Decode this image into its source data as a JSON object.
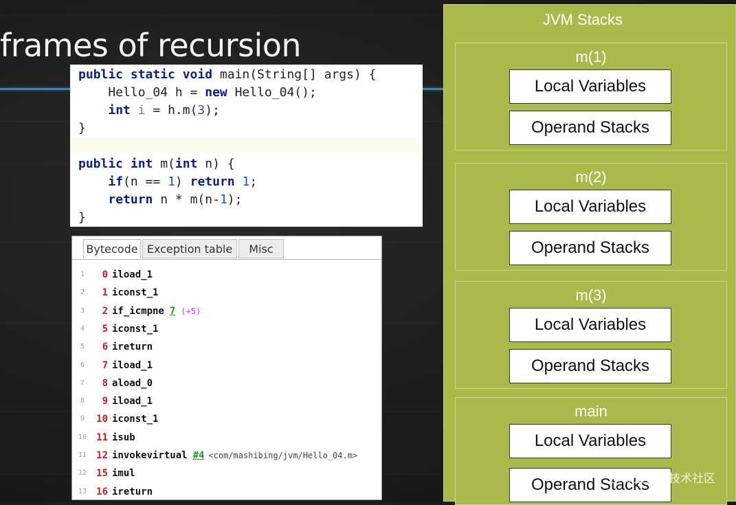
{
  "slide": {
    "title": "frames of recursion"
  },
  "code": {
    "lines": [
      [
        {
          "t": "public static void",
          "c": "kw"
        },
        {
          "t": " main(String[] args) {"
        }
      ],
      [
        {
          "t": "    Hello_04 h = "
        },
        {
          "t": "new",
          "c": "kw"
        },
        {
          "t": " Hello_04();"
        }
      ],
      [
        {
          "t": "    "
        },
        {
          "t": "int",
          "c": "kw"
        },
        {
          "t": " "
        },
        {
          "t": "i",
          "c": "var"
        },
        {
          "t": " = h.m("
        },
        {
          "t": "3",
          "c": "num"
        },
        {
          "t": ");"
        }
      ],
      [
        {
          "t": "}"
        }
      ],
      [
        {
          "t": ""
        }
      ],
      [
        {
          "t": "public int",
          "c": "kw"
        },
        {
          "t": " m("
        },
        {
          "t": "int",
          "c": "kw"
        },
        {
          "t": " n) {"
        }
      ],
      [
        {
          "t": "    "
        },
        {
          "t": "if",
          "c": "kw"
        },
        {
          "t": "(n == "
        },
        {
          "t": "1",
          "c": "num"
        },
        {
          "t": ") "
        },
        {
          "t": "return",
          "c": "kw"
        },
        {
          "t": " "
        },
        {
          "t": "1",
          "c": "num"
        },
        {
          "t": ";"
        }
      ],
      [
        {
          "t": "    "
        },
        {
          "t": "return",
          "c": "kw"
        },
        {
          "t": " n * m(n-"
        },
        {
          "t": "1",
          "c": "num"
        },
        {
          "t": ");"
        }
      ],
      [
        {
          "t": "}"
        }
      ]
    ]
  },
  "bytecode": {
    "tabs": [
      "Bytecode",
      "Exception table",
      "Misc"
    ],
    "active_tab": "Bytecode",
    "rows": [
      {
        "ln": "1",
        "off": "0",
        "op": "iload_1"
      },
      {
        "ln": "2",
        "off": "1",
        "op": "iconst_1"
      },
      {
        "ln": "3",
        "off": "2",
        "op": "if_icmpne",
        "arg": "7",
        "rel": "(+5)"
      },
      {
        "ln": "4",
        "off": "5",
        "op": "iconst_1"
      },
      {
        "ln": "5",
        "off": "6",
        "op": "ireturn"
      },
      {
        "ln": "6",
        "off": "7",
        "op": "iload_1"
      },
      {
        "ln": "7",
        "off": "8",
        "op": "aload_0"
      },
      {
        "ln": "8",
        "off": "9",
        "op": "iload_1"
      },
      {
        "ln": "9",
        "off": "10",
        "op": "iconst_1"
      },
      {
        "ln": "10",
        "off": "11",
        "op": "isub"
      },
      {
        "ln": "11",
        "off": "12",
        "op": "invokevirtual",
        "arg": "#4",
        "cmt": "<com/mashibing/jvm/Hello_04.m>"
      },
      {
        "ln": "12",
        "off": "15",
        "op": "imul"
      },
      {
        "ln": "13",
        "off": "16",
        "op": "ireturn"
      }
    ]
  },
  "jvm": {
    "title": "JVM Stacks",
    "frames": [
      {
        "name": "m(1)",
        "local": "Local Variables",
        "operand": "Operand Stacks"
      },
      {
        "name": "m(2)",
        "local": "Local Variables",
        "operand": "Operand Stacks"
      },
      {
        "name": "m(3)",
        "local": "Local Variables",
        "operand": "Operand Stacks"
      },
      {
        "name": "main",
        "local": "Local Variables",
        "operand": "Operand Stacks"
      }
    ]
  },
  "watermark": "@稀土掘金技术社区",
  "colors": {
    "panel": "#a9b94a",
    "accent_line": "#3a86b4",
    "keyword": "#0b1f8a",
    "offset": "#cc1a1a",
    "branch_target": "#1c9a2e",
    "relative_offset": "#d83ad8"
  }
}
